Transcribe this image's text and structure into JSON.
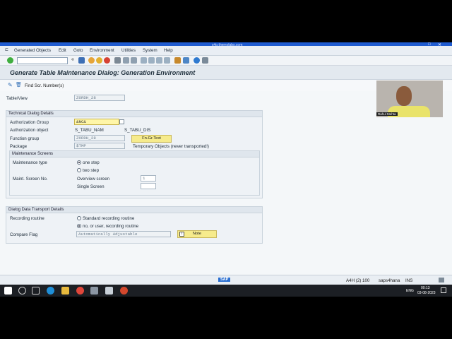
{
  "window": {
    "url": "s4p.themolabs.com"
  },
  "menu": [
    "Generated Objects",
    "Edit",
    "Goto",
    "Environment",
    "Utilities",
    "System",
    "Help"
  ],
  "page_title": "Generate Table Maintenance Dialog: Generation Environment",
  "app_toolbar": {
    "find_label": "Find Scr. Number(s)"
  },
  "table_view": {
    "label": "Table/View",
    "value": "ZORDH_28"
  },
  "technical": {
    "header": "Technical Dialog Details",
    "auth_group_label": "Authorization Group",
    "auth_group_value": "&NC&",
    "auth_object_label": "Authorization object",
    "auth_object_value": "S_TABU_NAM",
    "auth_object_value2": "S_TABU_DIS",
    "function_group_label": "Function group",
    "function_group_value": "ZORDH_28",
    "fn_button": "Fn.Gr.Text",
    "package_label": "Package",
    "package_value": "$TMP",
    "package_note": "Temporary Objects (never transported!)"
  },
  "maintenance": {
    "header": "Maintenance Screens",
    "type_label": "Maintenance type",
    "one_step": "one step",
    "two_step": "two step",
    "screen_no_label": "Maint. Screen No.",
    "overview_label": "Overview screen",
    "overview_value": "1",
    "single_label": "Single Screen",
    "single_value": ""
  },
  "transport": {
    "header": "Dialog Data Transport Details",
    "recording_label": "Recording routine",
    "standard": "Standard recording routine",
    "no_user": "no, or user, recording routine",
    "compare_label": "Compare Flag",
    "compare_value": "Automatically Adjustable",
    "note_button": "Note"
  },
  "status": {
    "system": "A4H (2) 100",
    "server": "saps4hana",
    "mode": "INS",
    "logo": "SAP"
  },
  "video": {
    "name": "Rahul Mehta"
  },
  "taskbar": {
    "time": "00:13",
    "date": "03-08-2023",
    "lang": "ENG"
  }
}
